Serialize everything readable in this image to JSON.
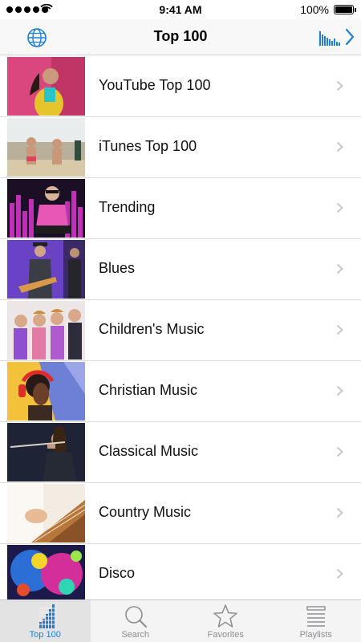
{
  "status_bar": {
    "time": "9:41 AM",
    "battery": "100%"
  },
  "nav": {
    "title": "Top 100"
  },
  "list": {
    "items": [
      {
        "label": "YouTube Top 100"
      },
      {
        "label": "iTunes Top 100"
      },
      {
        "label": "Trending"
      },
      {
        "label": "Blues"
      },
      {
        "label": "Children's Music"
      },
      {
        "label": "Christian Music"
      },
      {
        "label": "Classical Music"
      },
      {
        "label": "Country Music"
      },
      {
        "label": "Disco"
      }
    ]
  },
  "tabs": [
    {
      "label": "Top 100",
      "icon": "bars-icon",
      "active": true
    },
    {
      "label": "Search",
      "icon": "search-icon",
      "active": false
    },
    {
      "label": "Favorites",
      "icon": "star-icon",
      "active": false
    },
    {
      "label": "Playlists",
      "icon": "list-icon",
      "active": false
    }
  ],
  "colors": {
    "accent": "#1f7ed6",
    "inactive": "#8e8e93"
  }
}
